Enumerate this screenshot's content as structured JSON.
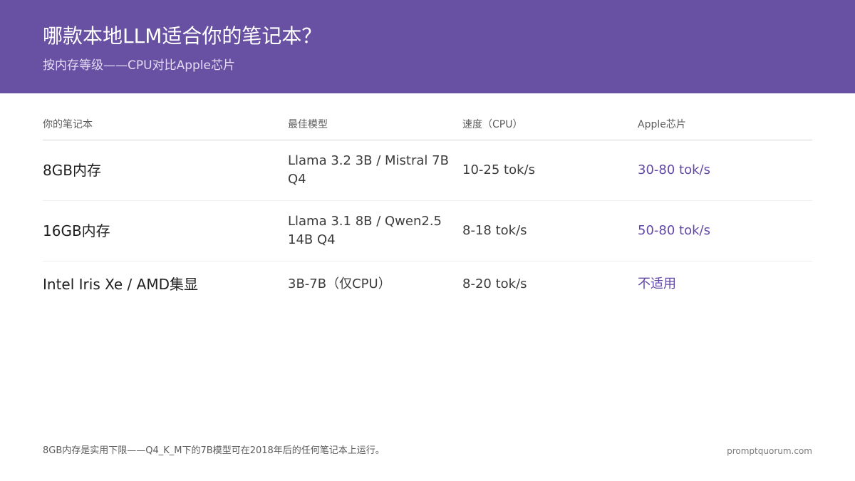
{
  "header": {
    "title": "哪款本地LLM适合你的笔记本？",
    "subtitle": "按内存等级——CPU对比Apple芯片"
  },
  "table": {
    "columns": [
      "你的笔记本",
      "最佳模型",
      "速度（CPU）",
      "Apple芯片"
    ],
    "rows": [
      {
        "laptop": "8GB内存",
        "model": "Llama 3.2 3B / Mistral 7B Q4",
        "cpu_speed": "10-25 tok/s",
        "apple_speed": "30-80 tok/s"
      },
      {
        "laptop": "16GB内存",
        "model": "Llama 3.1 8B / Qwen2.5 14B Q4",
        "cpu_speed": "8-18 tok/s",
        "apple_speed": "50-80 tok/s"
      },
      {
        "laptop": "Intel Iris Xe / AMD集显",
        "model": "3B-7B（仅CPU）",
        "cpu_speed": "8-20 tok/s",
        "apple_speed": "不适用"
      }
    ]
  },
  "footer": {
    "note": "8GB内存是实用下限——Q4_K_M下的7B模型可在2018年后的任何笔记本上运行。",
    "site": "promptquorum.com"
  },
  "colors": {
    "header_bg": "#6851a3",
    "accent": "#6248a5"
  }
}
